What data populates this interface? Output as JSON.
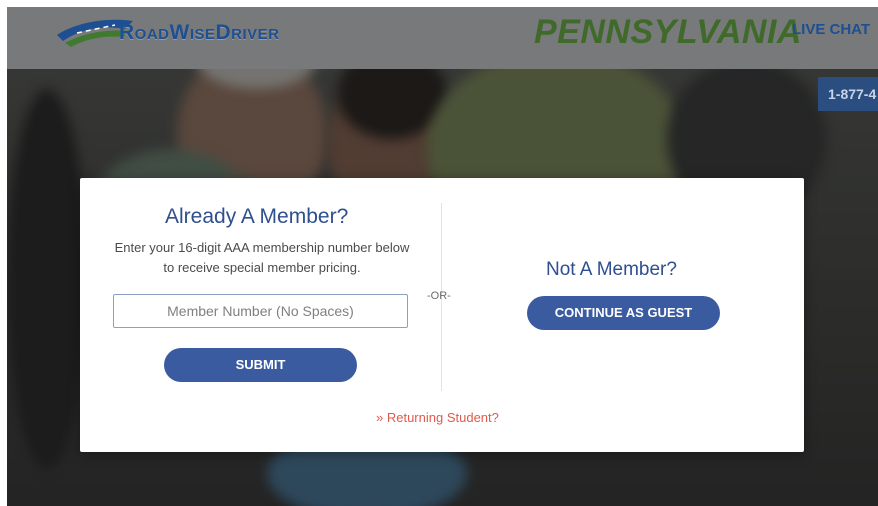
{
  "header": {
    "logo_text": "RoadWiseDriver",
    "state": "PENNSYLVANIA",
    "live_chat": "LIVE CHAT",
    "phone": "1-877-4"
  },
  "modal": {
    "member_title": "Already A Member?",
    "member_desc": "Enter your 16-digit AAA membership number below to receive special member pricing.",
    "member_input_placeholder": "Member Number (No Spaces)",
    "member_input_value": "",
    "submit_label": "SUBMIT",
    "or_label": "-OR-",
    "nonmember_title": "Not A Member?",
    "guest_label": "CONTINUE AS GUEST",
    "returning_label": "» Returning Student?"
  },
  "icons": {
    "logo": "road-swoosh-icon"
  },
  "colors": {
    "brand_blue": "#3b5ba1",
    "title_blue": "#2f4f8f",
    "state_green": "#3f6a2a",
    "link_red": "#e05a4c"
  }
}
